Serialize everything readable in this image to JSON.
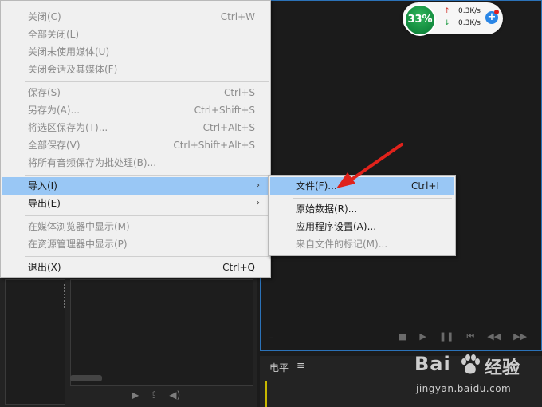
{
  "file_menu": {
    "items": [
      {
        "label": "关闭(C)",
        "shortcut": "Ctrl+W"
      },
      {
        "label": "全部关闭(L)",
        "shortcut": ""
      },
      {
        "label": "关闭未使用媒体(U)",
        "shortcut": ""
      },
      {
        "label": "关闭会话及其媒体(F)",
        "shortcut": ""
      },
      {
        "label": "保存(S)",
        "shortcut": "Ctrl+S"
      },
      {
        "label": "另存为(A)...",
        "shortcut": "Ctrl+Shift+S"
      },
      {
        "label": "将选区保存为(T)...",
        "shortcut": "Ctrl+Alt+S"
      },
      {
        "label": "全部保存(V)",
        "shortcut": "Ctrl+Shift+Alt+S"
      },
      {
        "label": "将所有音频保存为批处理(B)...",
        "shortcut": ""
      },
      {
        "label": "导入(I)",
        "shortcut": ""
      },
      {
        "label": "导出(E)",
        "shortcut": ""
      },
      {
        "label": "在媒体浏览器中显示(M)",
        "shortcut": ""
      },
      {
        "label": "在资源管理器中显示(P)",
        "shortcut": ""
      },
      {
        "label": "退出(X)",
        "shortcut": "Ctrl+Q"
      }
    ],
    "submenu_arrow": "›"
  },
  "import_submenu": {
    "items": [
      {
        "label": "文件(F)...",
        "shortcut": "Ctrl+I"
      },
      {
        "label": "原始数据(R)...",
        "shortcut": ""
      },
      {
        "label": "应用程序设置(A)...",
        "shortcut": ""
      },
      {
        "label": "来自文件的标记(M)...",
        "shortcut": ""
      }
    ]
  },
  "net_widget": {
    "percent": "33%",
    "up_arrow": "↑",
    "down_arrow": "↓",
    "upload": "0.3K/s",
    "download": "0.3K/s",
    "plus": "+"
  },
  "level_panel": {
    "title": "电平",
    "menu_icon": "≡"
  },
  "transport": {
    "right": [
      "■",
      "▶",
      "❚❚",
      "⏮",
      "◀◀",
      "▶▶"
    ],
    "left": [
      "▶",
      "⇪",
      "◀)"
    ]
  },
  "watermark": {
    "brand": "Bai",
    "brand_cn": "经验",
    "url": "jingyan.baidu.com"
  },
  "colors": {
    "highlight": "#99c7f5",
    "panel_border": "#2b72b8",
    "arrow_red": "#e0221b",
    "menu_bg": "#f0f0f0"
  }
}
